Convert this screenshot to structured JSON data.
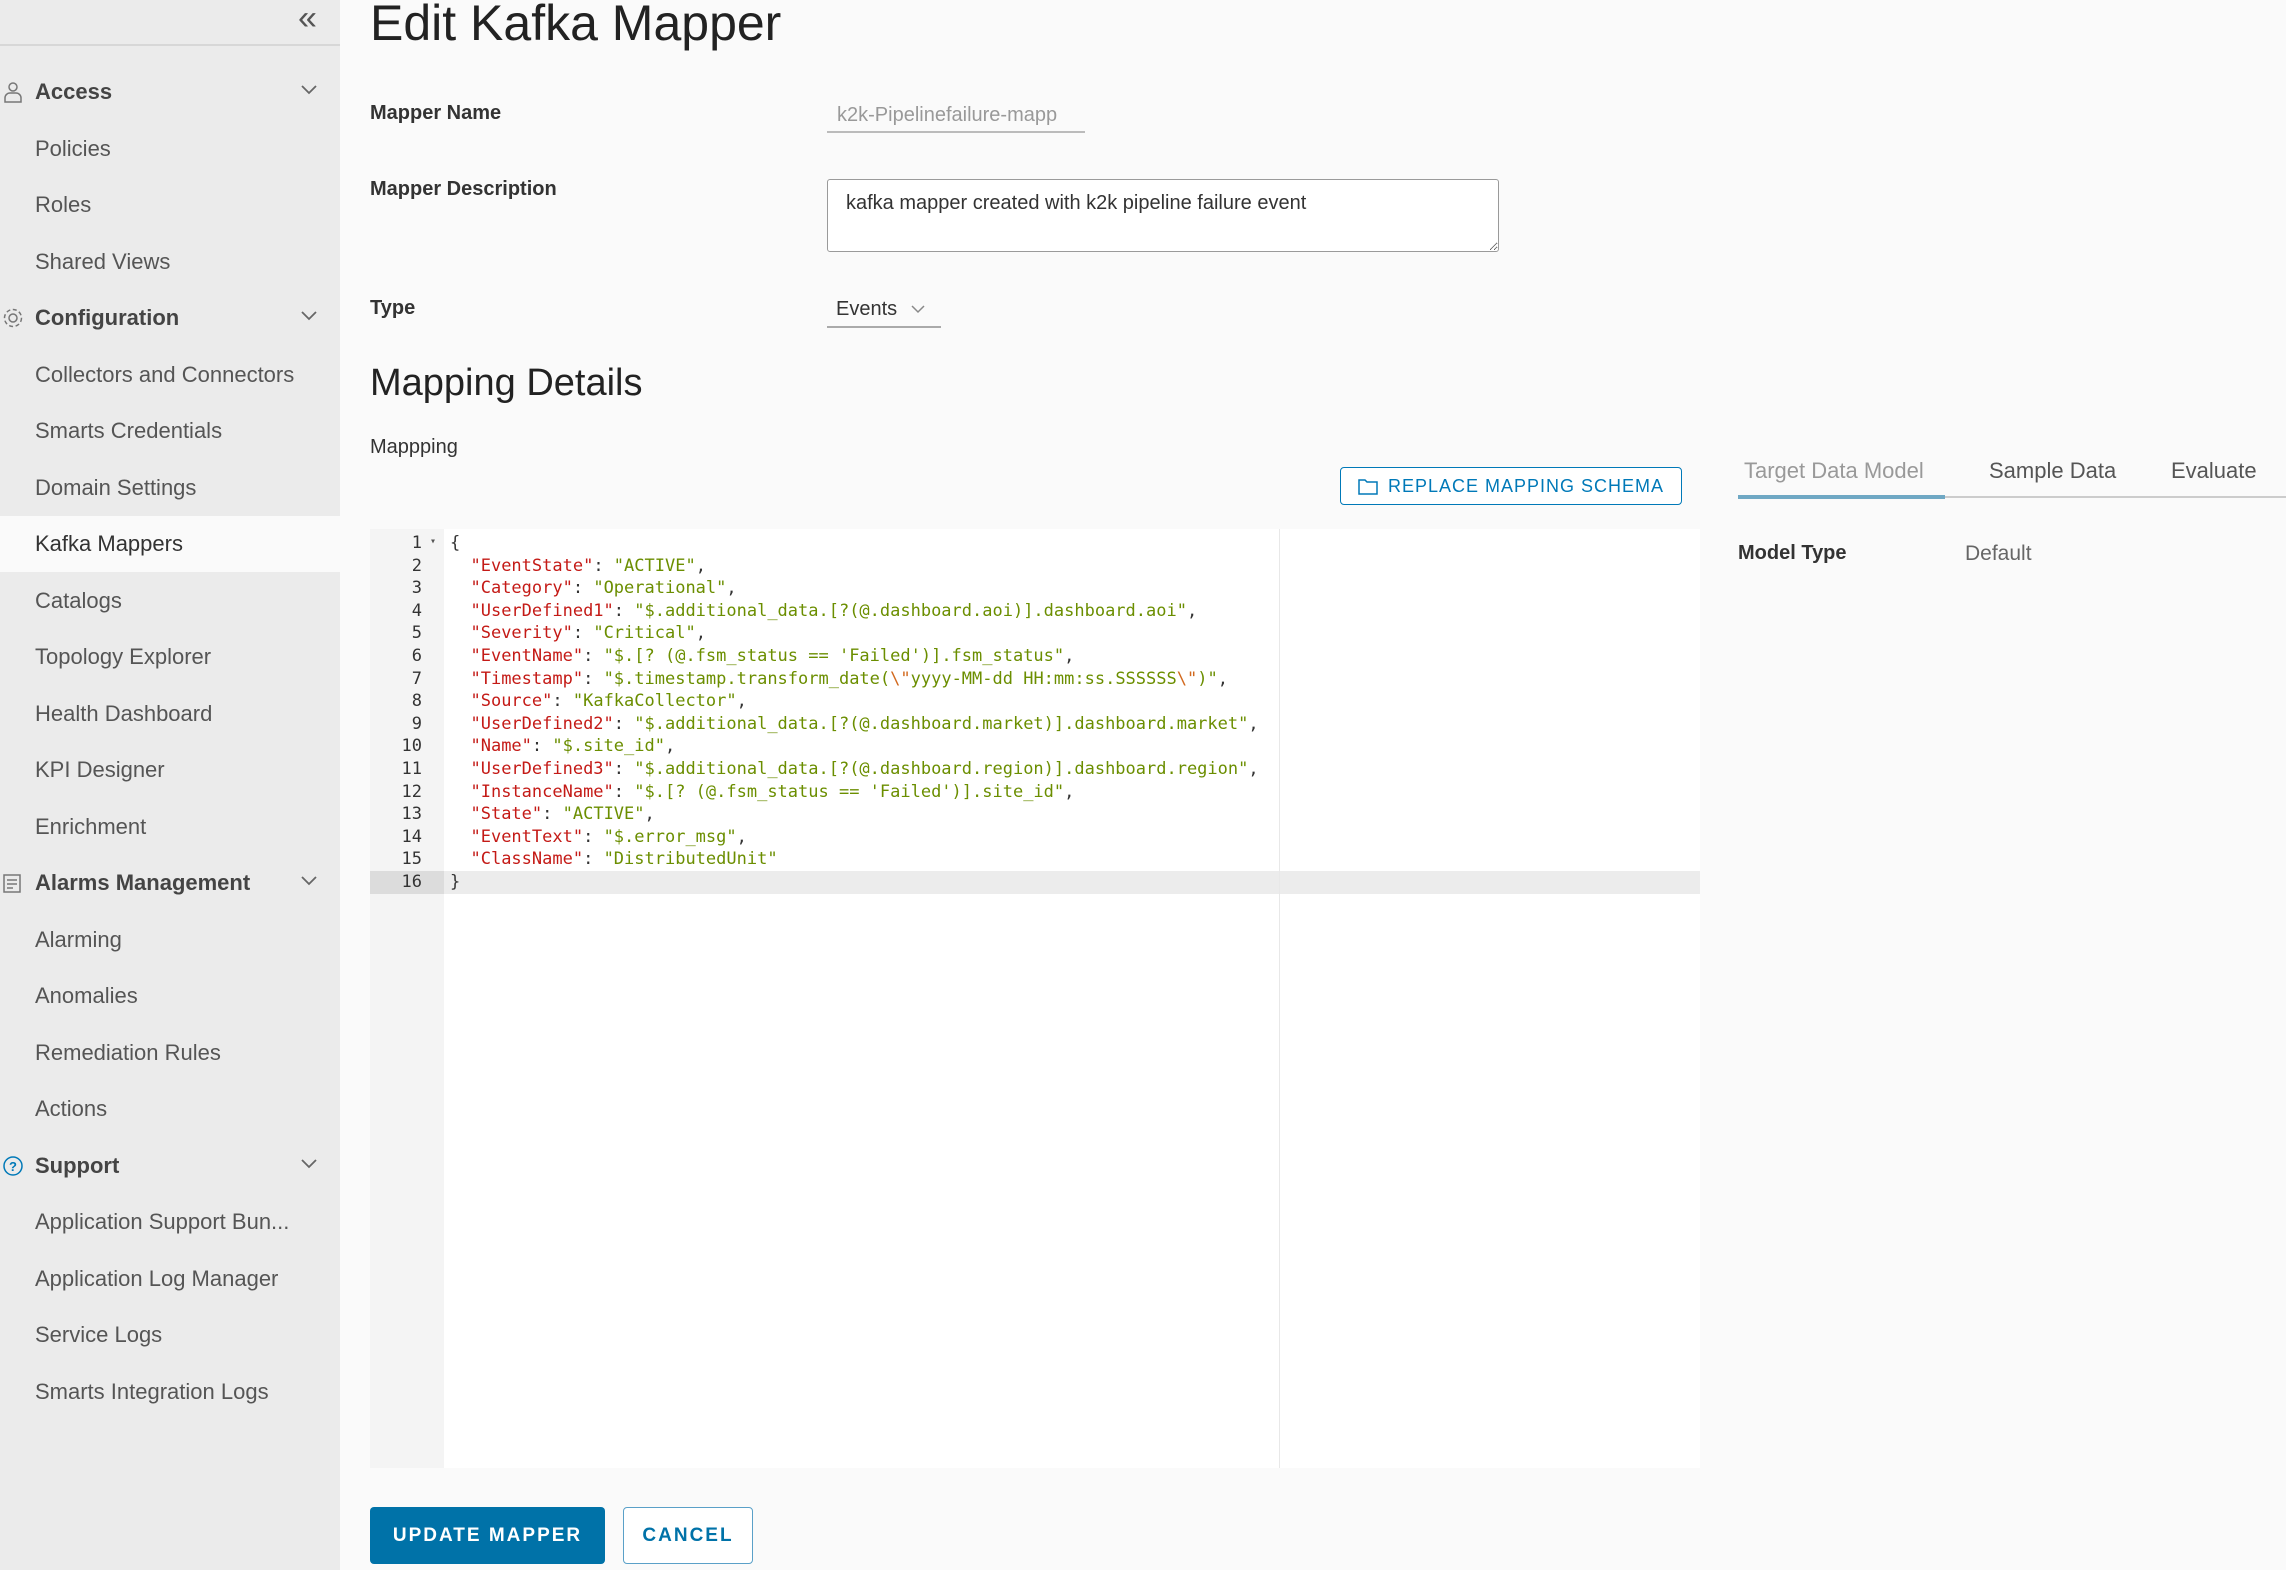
{
  "sidebar": {
    "collapse_icon": "double-chevron-left",
    "items": [
      {
        "label": "Access",
        "group": true,
        "icon": "user-icon"
      },
      {
        "label": "Policies"
      },
      {
        "label": "Roles"
      },
      {
        "label": "Shared Views"
      },
      {
        "label": "Configuration",
        "group": true,
        "icon": "gear-icon"
      },
      {
        "label": "Collectors and Connectors"
      },
      {
        "label": "Smarts Credentials"
      },
      {
        "label": "Domain Settings"
      },
      {
        "label": "Kafka Mappers",
        "selected": true
      },
      {
        "label": "Catalogs"
      },
      {
        "label": "Topology Explorer"
      },
      {
        "label": "Health Dashboard"
      },
      {
        "label": "KPI Designer"
      },
      {
        "label": "Enrichment"
      },
      {
        "label": "Alarms Management",
        "group": true,
        "icon": "alarm-list-icon"
      },
      {
        "label": "Alarming"
      },
      {
        "label": "Anomalies"
      },
      {
        "label": "Remediation Rules"
      },
      {
        "label": "Actions"
      },
      {
        "label": "Support",
        "group": true,
        "icon": "help-icon"
      },
      {
        "label": "Application Support Bun..."
      },
      {
        "label": "Application Log Manager"
      },
      {
        "label": "Service Logs"
      },
      {
        "label": "Smarts Integration Logs"
      }
    ]
  },
  "page": {
    "title": "Edit Kafka Mapper",
    "mapper_name_label": "Mapper Name",
    "mapper_name_value": "k2k-Pipelinefailure-mapp",
    "mapper_desc_label": "Mapper Description",
    "mapper_desc_value": "kafka mapper created with k2k pipeline failure event",
    "type_label": "Type",
    "type_value": "Events",
    "mapping_details_title": "Mapping Details",
    "mapping_label": "Mappping",
    "replace_button": "REPLACE MAPPING SCHEMA",
    "tabs": [
      {
        "label": "Target Data Model",
        "active": true
      },
      {
        "label": "Sample Data"
      },
      {
        "label": "Evaluate"
      }
    ],
    "model_type_label": "Model Type",
    "model_type_value": "Default",
    "update_button": "UPDATE MAPPER",
    "cancel_button": "CANCEL"
  },
  "editor": {
    "active_line": 16,
    "lines": [
      {
        "text": "{"
      },
      {
        "key": "EventState",
        "value": "ACTIVE"
      },
      {
        "key": "Category",
        "value": "Operational"
      },
      {
        "key": "UserDefined1",
        "value": "$.additional_data.[?(@.dashboard.aoi)].dashboard.aoi"
      },
      {
        "key": "Severity",
        "value": "Critical"
      },
      {
        "key": "EventName",
        "value": "$.[? (@.fsm_status == 'Failed')].fsm_status"
      },
      {
        "key": "Timestamp",
        "value": "$.timestamp.transform_date(\\\"yyyy-MM-dd HH:mm:ss.SSSSSS\\\")"
      },
      {
        "key": "Source",
        "value": "KafkaCollector"
      },
      {
        "key": "UserDefined2",
        "value": "$.additional_data.[?(@.dashboard.market)].dashboard.market"
      },
      {
        "key": "Name",
        "value": "$.site_id"
      },
      {
        "key": "UserDefined3",
        "value": "$.additional_data.[?(@.dashboard.region)].dashboard.region"
      },
      {
        "key": "InstanceName",
        "value": "$.[? (@.fsm_status == 'Failed')].site_id"
      },
      {
        "key": "State",
        "value": "ACTIVE"
      },
      {
        "key": "EventText",
        "value": "$.error_msg"
      },
      {
        "key": "ClassName",
        "value": "DistributedUnit",
        "last": true
      },
      {
        "text": "}"
      }
    ]
  },
  "colors": {
    "primary": "#0072a8",
    "key": "#c41a16",
    "string": "#6b8e00",
    "escape": "#d2691e"
  }
}
